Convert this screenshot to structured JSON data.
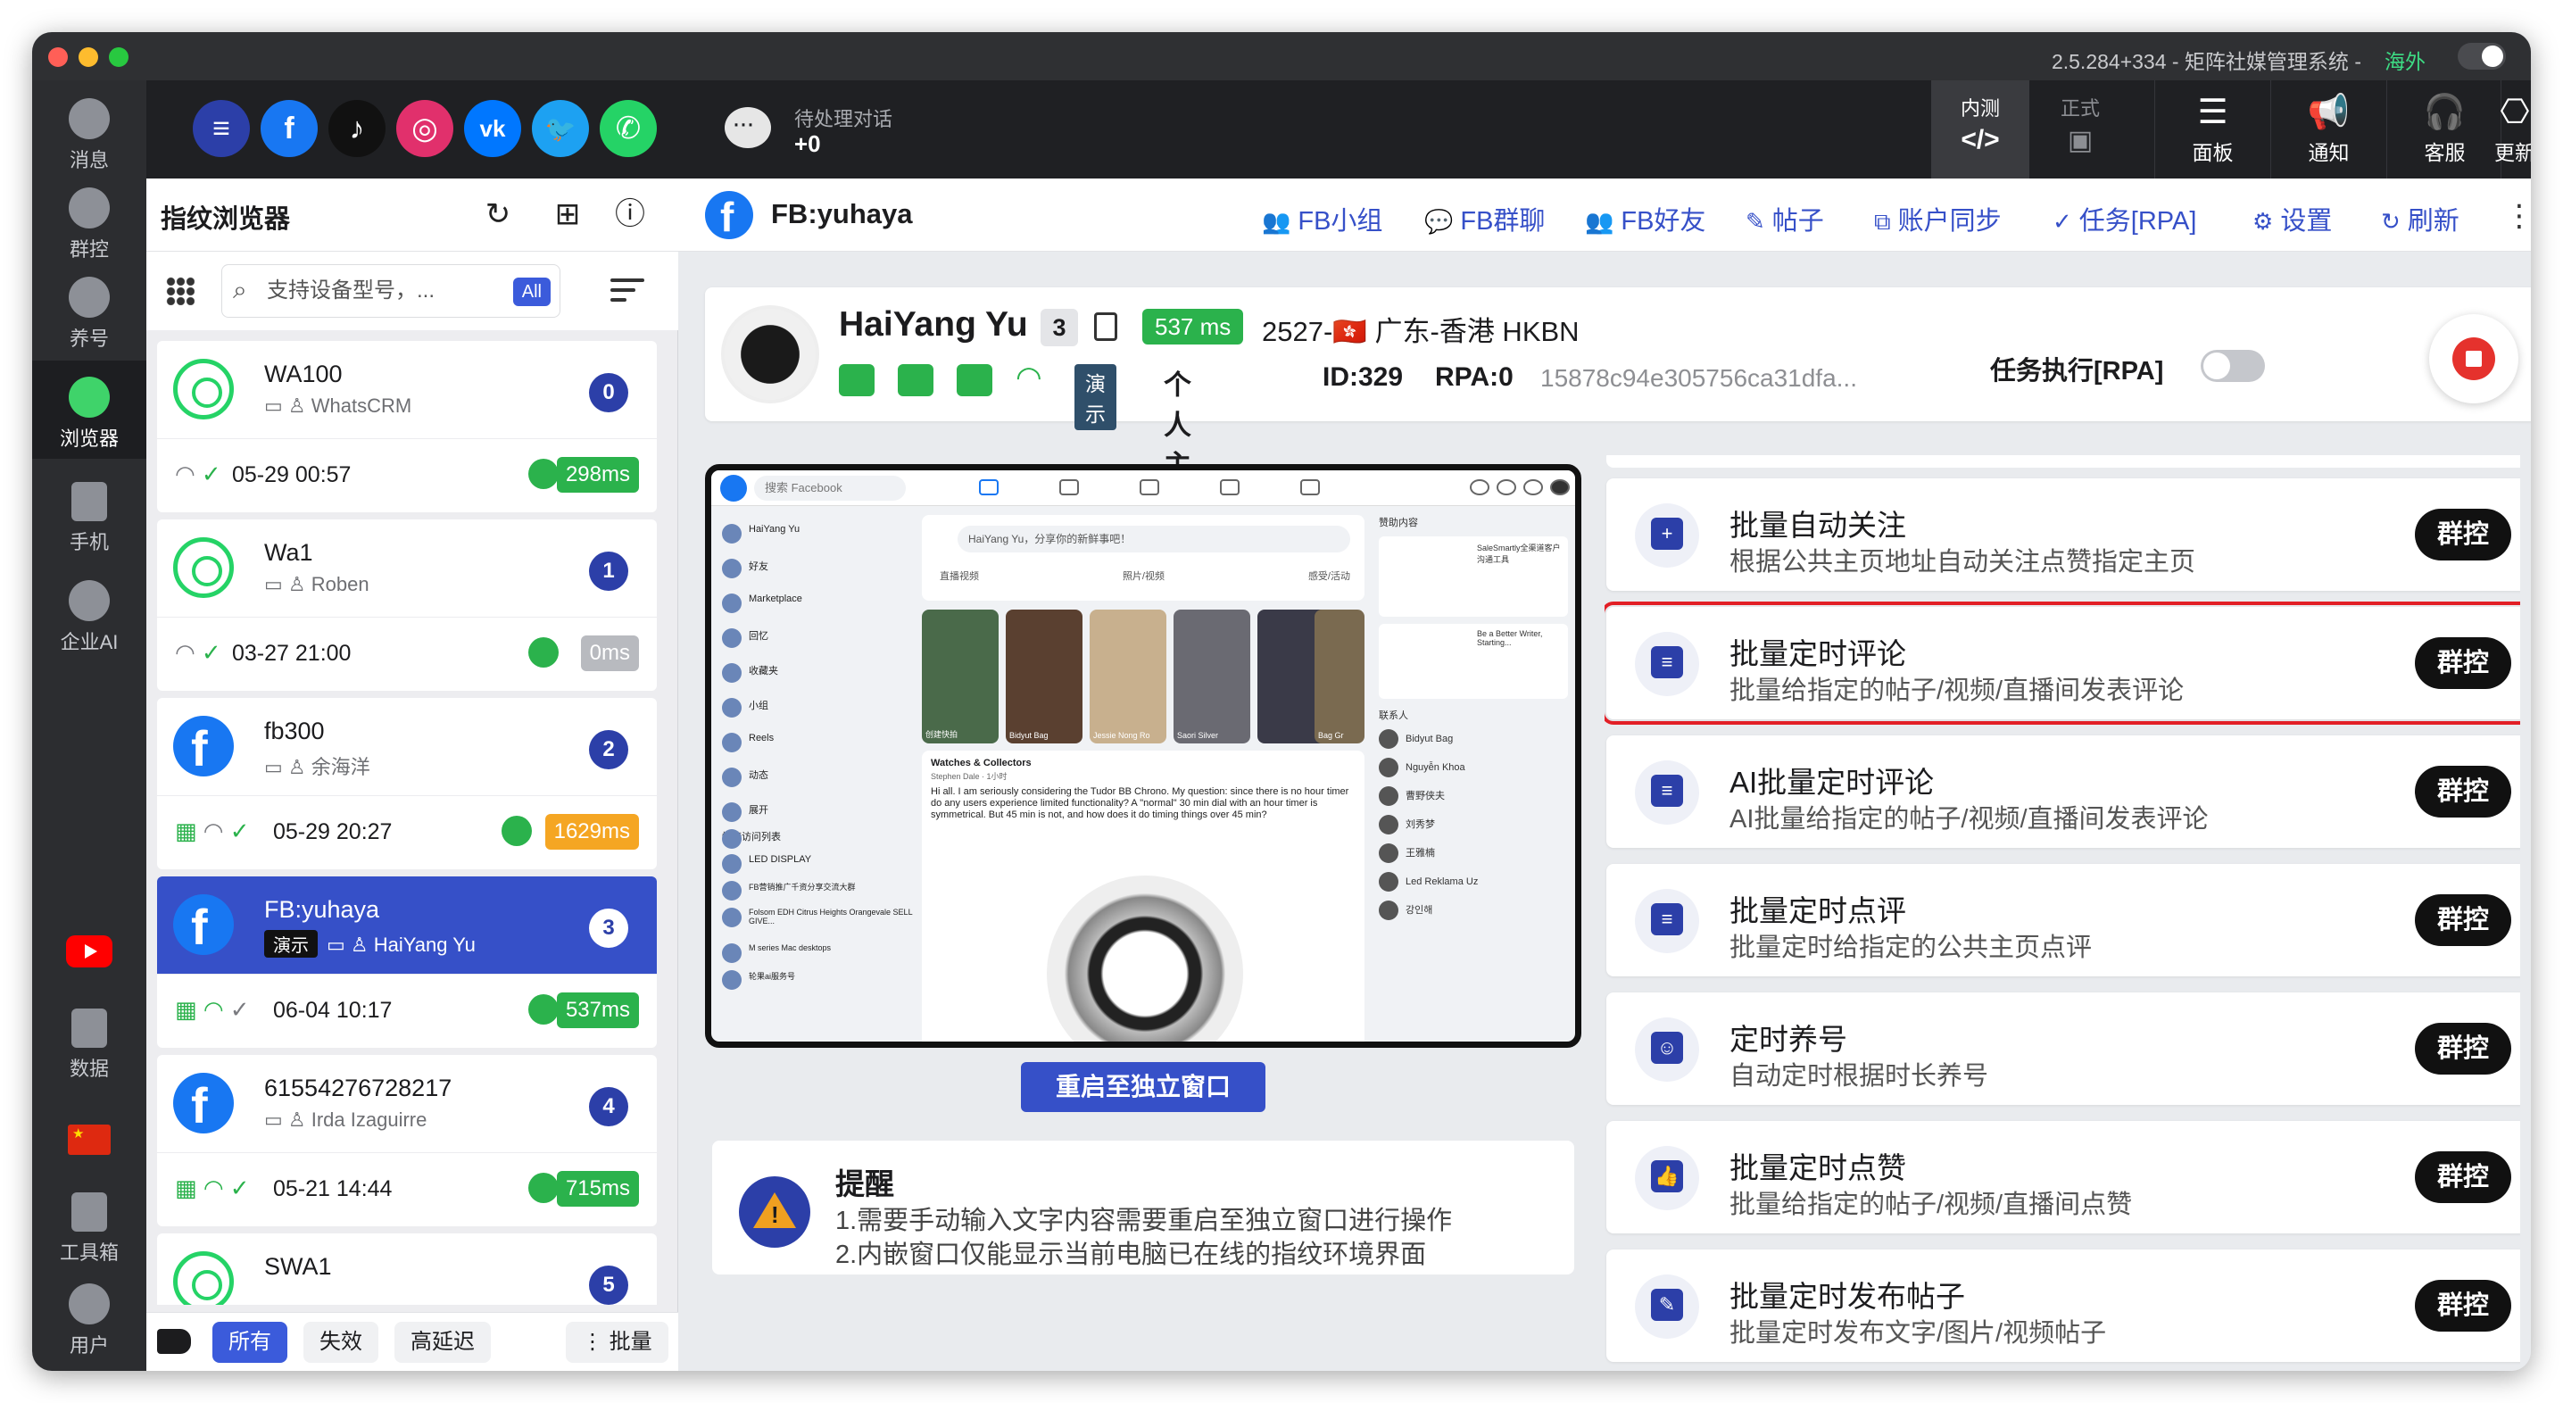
{
  "titlebar": {
    "app_title": "2.5.284+334 - 矩阵社媒管理系统 -",
    "region": "海外"
  },
  "rail": {
    "items": [
      {
        "label": "消息",
        "icon": "message-icon"
      },
      {
        "label": "群控",
        "icon": "group-control-icon"
      },
      {
        "label": "养号",
        "icon": "account-nurture-icon"
      },
      {
        "label": "浏览器",
        "icon": "browser-icon"
      },
      {
        "label": "手机",
        "icon": "phone-icon"
      },
      {
        "label": "企业AI",
        "icon": "enterprise-ai-icon"
      },
      {
        "label": "数据",
        "icon": "data-icon"
      },
      {
        "label": "工具箱",
        "icon": "toolbox-icon"
      },
      {
        "label": "用户",
        "icon": "user-icon"
      }
    ]
  },
  "appbar": {
    "socials": [
      {
        "name": "multi-platform",
        "color": "#2c3fa8",
        "glyph": "≡"
      },
      {
        "name": "facebook",
        "color": "#1877f2",
        "glyph": "f"
      },
      {
        "name": "tiktok",
        "color": "#111111",
        "glyph": "♪"
      },
      {
        "name": "instagram",
        "color": "#e1306c",
        "glyph": "◎"
      },
      {
        "name": "vk",
        "color": "#0077ff",
        "glyph": "vk"
      },
      {
        "name": "twitter",
        "color": "#1da1f2",
        "glyph": "🐦"
      },
      {
        "name": "whatsapp",
        "color": "#25d366",
        "glyph": "✆"
      }
    ],
    "pending_label": "待处理对话",
    "pending_count": "+0",
    "env_internal": "内测",
    "env_internal_symbol": "</>",
    "env_formal": "正式",
    "env_formal_symbol": "▣",
    "tools": [
      {
        "label": "面板",
        "symbol": "☰"
      },
      {
        "label": "通知",
        "symbol": "📢"
      },
      {
        "label": "客服",
        "symbol": "🎧"
      },
      {
        "label": "更新",
        "symbol": "⎔"
      }
    ]
  },
  "panel": {
    "title": "指纹浏览器",
    "search_placeholder": "支持设备型号，...",
    "search_scope": "All",
    "cards": [
      {
        "name": "WA100",
        "sub": "WhatsCRM",
        "num": "0",
        "time": "05-29 00:57",
        "ms": "298ms",
        "ms_color": "#2bb24c",
        "avatar": "wa",
        "store": false,
        "demo": ""
      },
      {
        "name": "Wa1",
        "sub": "Roben",
        "num": "1",
        "time": "03-27 21:00",
        "ms": "0ms",
        "ms_color": "#b8babf",
        "avatar": "wa",
        "store": false,
        "demo": ""
      },
      {
        "name": "fb300",
        "sub": "余海洋",
        "num": "2",
        "time": "05-29 20:27",
        "ms": "1629ms",
        "ms_color": "#f5a623",
        "avatar": "fb",
        "store": true,
        "demo": ""
      },
      {
        "name": "FB:yuhaya",
        "sub": "HaiYang Yu",
        "num": "3",
        "time": "06-04 10:17",
        "ms": "537ms",
        "ms_color": "#2bb24c",
        "avatar": "fb",
        "store": true,
        "demo": "演示"
      },
      {
        "name": "61554276728217",
        "sub": "Irda Izaguirre",
        "num": "4",
        "time": "05-21 14:44",
        "ms": "715ms",
        "ms_color": "#2bb24c",
        "avatar": "fb",
        "store": true,
        "demo": ""
      },
      {
        "name": "SWA1",
        "sub": "",
        "num": "5",
        "time": "",
        "ms": "",
        "ms_color": "#2bb24c",
        "avatar": "wa",
        "store": false,
        "demo": ""
      }
    ],
    "filters": {
      "all": "所有",
      "invalid": "失效",
      "high_latency": "高延迟",
      "batch": "批量"
    }
  },
  "main": {
    "title": "FB:yuhaya",
    "nav": [
      {
        "label": "FB小组",
        "glyph": "👥"
      },
      {
        "label": "FB群聊",
        "glyph": "💬"
      },
      {
        "label": "FB好友",
        "glyph": "👥"
      },
      {
        "label": "帖子",
        "glyph": "✎"
      },
      {
        "label": "账户同步",
        "glyph": "⧉"
      },
      {
        "label": "任务[RPA]",
        "glyph": "✓"
      },
      {
        "label": "设置",
        "glyph": "⚙"
      },
      {
        "label": "刷新",
        "glyph": "↻"
      }
    ],
    "profile": {
      "name": "HaiYang Yu",
      "count": "3",
      "ms": "537 ms",
      "location": "2527-🇭🇰 广东-香港 HKBN",
      "demo": "演示",
      "home": "个人主页●",
      "id": "ID:329",
      "rpa": "RPA:0",
      "hash": "15878c94e305756ca31dfa...",
      "rpa_task_label": "任务执行[RPA]"
    },
    "embed": {
      "search": "搜索 Facebook",
      "sidebar": [
        "HaiYang Yu",
        "好友",
        "Marketplace",
        "回忆",
        "收藏夹",
        "小组",
        "Reels",
        "动态",
        "展开",
        "快捷访问列表",
        "LED DISPLAY",
        "FB营销推广千资分享交流大群",
        "Folsom EDH Citrus Heights Orangevale SELL GIVE...",
        "M series Mac desktops",
        "轮果ai服务号"
      ],
      "composer": "HaiYang Yu，分享你的新鲜事吧！",
      "composer_actions": [
        "直播视频",
        "照片/视频",
        "感受/活动"
      ],
      "stories": [
        "创建快拍",
        "Bidyut Bag",
        "Jessie Nong Ro",
        "Saori Silver",
        "Bag Gr"
      ],
      "post_title": "Watches & Collectors",
      "post_author": "Stephen Dale · 1小时",
      "post_text": "Hi all. I am seriously considering the Tudor BB Chrono. My question: since there is no hour timer do any users experience limited functionality? A \"normal\" 30 min dial with an hour timer is symmetrical. But 45 min is not, and how does it do timing things over 45 min?",
      "sponsored_label": "赞助内容",
      "sponsored_1": "SaleSmartly全渠道客户沟通工具",
      "sponsored_2": "Be a Better Writer, Starting...",
      "contacts_label": "联系人",
      "contacts": [
        "Bidyut Bag",
        "Nguyễn Khoa",
        "曹野侠夫",
        "刘秀梦",
        "王雅楠",
        "Led Reklama Uz",
        "강인해"
      ]
    },
    "restart_label": "重启至独立窗口",
    "reminder": {
      "title": "提醒",
      "line1": "1.需要手动输入文字内容需要重启至独立窗口进行操作",
      "line2": "2.内嵌窗口仅能显示当前电脑已在线的指纹环境界面"
    },
    "tasks": [
      {
        "title": "批量自动关注",
        "desc": "根据公共主页地址自动关注点赞指定主页",
        "btn": "群控",
        "icon": "add-user-icon",
        "glyph": "+"
      },
      {
        "title": "批量定时评论",
        "desc": "批量给指定的帖子/视频/直播间发表评论",
        "btn": "群控",
        "icon": "comment-icon",
        "glyph": "≡"
      },
      {
        "title": "AI批量定时评论",
        "desc": "AI批量给指定的帖子/视频/直播间发表评论",
        "btn": "群控",
        "icon": "ai-comment-icon",
        "glyph": "≡"
      },
      {
        "title": "批量定时点评",
        "desc": "批量定时给指定的公共主页点评",
        "btn": "群控",
        "icon": "review-icon",
        "glyph": "≡"
      },
      {
        "title": "定时养号",
        "desc": "自动定时根据时长养号",
        "btn": "群控",
        "icon": "robot-icon",
        "glyph": "☺"
      },
      {
        "title": "批量定时点赞",
        "desc": "批量给指定的帖子/视频/直播间点赞",
        "btn": "群控",
        "icon": "thumbs-up-icon",
        "glyph": "👍"
      },
      {
        "title": "批量定时发布帖子",
        "desc": "批量定时发布文字/图片/视频帖子",
        "btn": "群控",
        "icon": "post-icon",
        "glyph": "✎"
      }
    ]
  }
}
